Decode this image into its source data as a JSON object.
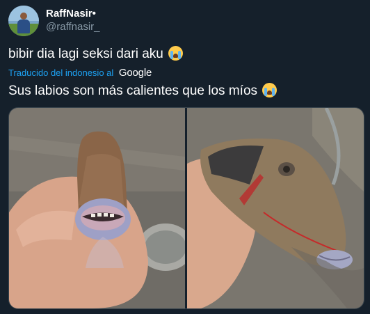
{
  "tweet": {
    "display_name": "RaffNasir•",
    "handle": "@raffnasir_",
    "text": "bibir dia lagi seksi dari aku",
    "translate_label": "Traducido del indonesio al",
    "translate_provider": "Google",
    "translated_text": "Sus labios son más calientes que los míos",
    "emoji_name": "loudly-crying-face-emoji"
  },
  "media": {
    "left_photo": "fish-lips-front-photo",
    "right_photo": "fish-lips-side-photo"
  },
  "colors": {
    "background": "#15202b",
    "text": "#ffffff",
    "secondary_text": "#8899a6",
    "link": "#1da1f2",
    "border": "#38444d"
  }
}
